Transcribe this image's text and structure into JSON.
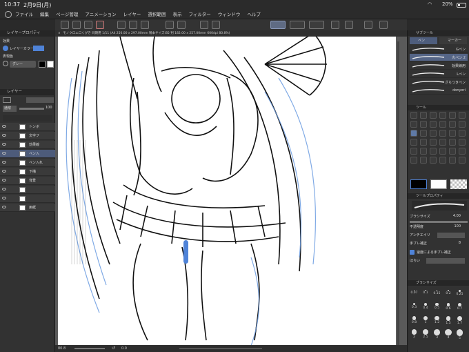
{
  "status": {
    "time": "10:37",
    "date": "2月9日(月)",
    "battery": "20%"
  },
  "menu": [
    "ファイル",
    "編集",
    "ページ管理",
    "アニメーション",
    "レイヤー",
    "選択範囲",
    "表示",
    "フィルター",
    "ウィンドウ",
    "ヘルプ"
  ],
  "left": {
    "layer_property_title": "レイヤープロパティ",
    "effect_label": "効果",
    "layer_color_label": "レイヤーカラー",
    "expression_color_label": "表現色",
    "expression_color_value": "グレー",
    "layer_title": "レイヤー",
    "blend_mode": "通常",
    "opacity": "100",
    "layers": [
      "トンボ",
      "文字フ",
      "効果線",
      "ペン入",
      "ペン入れ",
      "下描",
      "背景",
      "",
      "",
      "用紙"
    ]
  },
  "canvas": {
    "tab_title": "モノクロエロくがき 同期用 1/11 (A4 250.00 x 297.00mm 製本サイズ:B5 判 182.00 x 257.00mm 600dpi 80.8%)",
    "zoom": "80.8",
    "rotation": "0.0"
  },
  "right": {
    "subtool_title": "サブツール",
    "tab_pen": "ペン",
    "tab_marker": "マーカー",
    "subtools": [
      "Gペン",
      "丸ペン 2",
      "効果線用",
      "Lペン",
      "ざらつきペン",
      "donyori"
    ],
    "tool_title": "ツール",
    "tool_property_title": "ツールプロパティ",
    "brush_size_label": "ブラシサイズ",
    "brush_size_value": "4.00",
    "opacity_label": "不透明度",
    "opacity_value": "100",
    "antialias_label": "アンチエイリ",
    "stabilization_label": "手ブレ補正",
    "stabilization_value": "8",
    "speed_stabilization_label": "速度による手ブレ補正",
    "vector_label": "ほらい",
    "brush_size_panel_title": "ブラシサイズ",
    "sizes": [
      "0.07",
      "0.1",
      "0.15",
      "0.2",
      "0.25",
      "0.3",
      "0.4",
      "0.5",
      "0.6",
      "0.7",
      "0.8",
      "1",
      "1.2",
      "1.5",
      "1.7",
      "2",
      "2.5",
      "3",
      "4",
      "5"
    ]
  },
  "colors": {
    "accent": "#4f83d8",
    "main": "#000000",
    "sub": "#ffffff",
    "panel": "#323232"
  }
}
